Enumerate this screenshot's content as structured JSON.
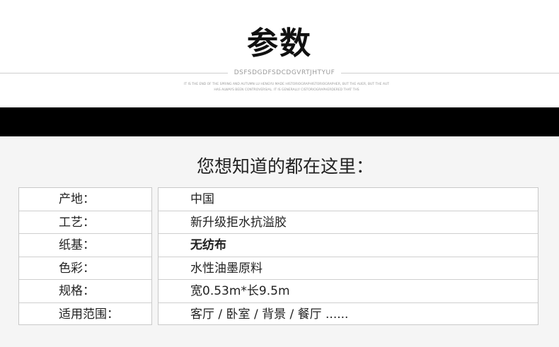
{
  "header": {
    "title": "参数",
    "subtitle": "DSFSDGDFSDCDGVRTJHTYUF",
    "note_line1": "IT IS THE END OF THE SPRING AND AUTUMN LU HENGYU MADE HISTORIOGRAPHISTORIOGRAPHER, BUT THE AUER, BUT THE AUT",
    "note_line2": "HAS ALWAYS BEEN CONTROVERSIAL. IT IS GENERALLY CISTORIOGRAPHERDERED THAT THS"
  },
  "section": {
    "heading": "您想知道的都在这里："
  },
  "specs": [
    {
      "label": "产地：",
      "value": "中国"
    },
    {
      "label": "工艺：",
      "value": "新升级拒水抗溢胶"
    },
    {
      "label": "纸基：",
      "value": "无纺布"
    },
    {
      "label": "色彩：",
      "value": "水性油墨原料"
    },
    {
      "label": "规格：",
      "value": "宽0.53m*长9.5m"
    },
    {
      "label": "适用范围：",
      "value": "客厅 / 卧室 / 背景 / 餐厅 ......"
    }
  ],
  "colors": {
    "band": "#000000",
    "panel": "#f5f5f5",
    "border": "#c9c9c9"
  }
}
